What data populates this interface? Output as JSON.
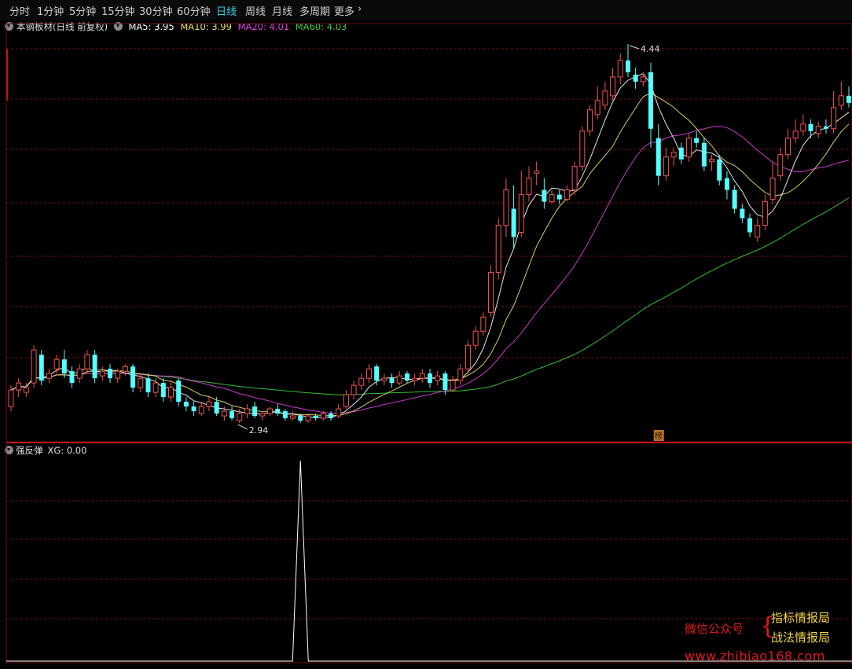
{
  "toolbar": {
    "periods": [
      "分时",
      "1分钟",
      "5分钟",
      "15分钟",
      "30分钟",
      "60分钟",
      "日线",
      "周线",
      "月线",
      "多周期",
      "更多"
    ],
    "active": "日线",
    "more_arrow": "›"
  },
  "main_panel": {
    "stock_title": "本钢板材(日线 前复权)",
    "ma": [
      {
        "label": "MA5: 3.95",
        "color": "#ffffff"
      },
      {
        "label": "MA10: 3.99",
        "color": "#f0e06a"
      },
      {
        "label": "MA20: 4.01",
        "color": "#e040e0"
      },
      {
        "label": "MA60: 4.03",
        "color": "#3ad13a"
      }
    ],
    "high_label": "4.44",
    "low_label": "2.94",
    "badge": "榜"
  },
  "indicator_panel": {
    "name": "强反弹",
    "value_label": "XG: 0.00"
  },
  "watermark": {
    "account": "微信公众号",
    "line1": "指标情报局",
    "line2": "战法情报局",
    "url": "www.zhibiao168.com"
  },
  "colors": {
    "up": "#f0544f",
    "down": "#54ffff",
    "ma5": "#ffffff",
    "ma10": "#f0e06a",
    "ma20": "#e040e0",
    "ma60": "#3ad13a",
    "grid": "#7a1010"
  },
  "chart_data": {
    "type": "candlestick",
    "price_axis_note": "no axis ticks shown",
    "candles": [
      [
        2.98,
        3.05,
        3.07,
        2.96
      ],
      [
        3.05,
        3.08,
        3.1,
        3.02
      ],
      [
        3.04,
        3.06,
        3.08,
        3.02
      ],
      [
        3.08,
        3.22,
        3.24,
        3.06
      ],
      [
        3.2,
        3.09,
        3.22,
        3.07
      ],
      [
        3.1,
        3.12,
        3.14,
        3.08
      ],
      [
        3.14,
        3.18,
        3.2,
        3.12
      ],
      [
        3.18,
        3.12,
        3.22,
        3.1
      ],
      [
        3.13,
        3.08,
        3.15,
        3.06
      ],
      [
        3.1,
        3.14,
        3.16,
        3.08
      ],
      [
        3.14,
        3.2,
        3.22,
        3.12
      ],
      [
        3.2,
        3.1,
        3.22,
        3.08
      ],
      [
        3.11,
        3.13,
        3.15,
        3.09
      ],
      [
        3.14,
        3.1,
        3.16,
        3.08
      ],
      [
        3.1,
        3.13,
        3.14,
        3.08
      ],
      [
        3.13,
        3.15,
        3.16,
        3.11
      ],
      [
        3.15,
        3.06,
        3.16,
        3.04
      ],
      [
        3.06,
        3.1,
        3.12,
        3.04
      ],
      [
        3.1,
        3.04,
        3.12,
        3.02
      ],
      [
        3.04,
        3.08,
        3.1,
        3.02
      ],
      [
        3.08,
        3.02,
        3.1,
        3.0
      ],
      [
        3.02,
        3.06,
        3.08,
        3.0
      ],
      [
        3.09,
        3.0,
        3.1,
        2.98
      ],
      [
        3.0,
        2.98,
        3.02,
        2.96
      ],
      [
        2.98,
        2.96,
        3.0,
        2.94
      ],
      [
        2.95,
        2.98,
        3.0,
        2.94
      ],
      [
        2.98,
        3.0,
        3.02,
        2.96
      ],
      [
        3.0,
        2.95,
        3.02,
        2.94
      ],
      [
        2.94,
        2.96,
        2.98,
        2.92
      ],
      [
        2.96,
        2.93,
        2.98,
        2.92
      ],
      [
        2.92,
        2.95,
        2.97,
        2.91
      ],
      [
        2.95,
        2.97,
        2.99,
        2.93
      ],
      [
        2.98,
        2.94,
        3.0,
        2.93
      ],
      [
        2.94,
        2.95,
        2.96,
        2.92
      ],
      [
        2.95,
        2.97,
        2.98,
        2.94
      ],
      [
        2.97,
        2.95,
        2.99,
        2.94
      ],
      [
        2.96,
        2.93,
        2.97,
        2.92
      ],
      [
        2.93,
        2.94,
        2.96,
        2.92
      ],
      [
        2.94,
        2.92,
        2.95,
        2.91
      ],
      [
        2.92,
        2.94,
        2.95,
        2.91
      ],
      [
        2.94,
        2.93,
        2.95,
        2.92
      ],
      [
        2.93,
        2.95,
        2.96,
        2.92
      ],
      [
        2.95,
        2.93,
        2.96,
        2.92
      ],
      [
        2.94,
        2.97,
        2.99,
        2.93
      ],
      [
        2.98,
        3.03,
        3.05,
        2.97
      ],
      [
        3.03,
        3.07,
        3.09,
        3.01
      ],
      [
        3.07,
        3.1,
        3.12,
        3.05
      ],
      [
        3.1,
        3.14,
        3.16,
        3.08
      ],
      [
        3.15,
        3.09,
        3.16,
        3.07
      ],
      [
        3.09,
        3.1,
        3.12,
        3.07
      ],
      [
        3.1,
        3.08,
        3.12,
        3.06
      ],
      [
        3.08,
        3.11,
        3.13,
        3.07
      ],
      [
        3.12,
        3.09,
        3.13,
        3.08
      ],
      [
        3.09,
        3.1,
        3.12,
        3.07
      ],
      [
        3.1,
        3.12,
        3.14,
        3.08
      ],
      [
        3.12,
        3.08,
        3.14,
        3.06
      ],
      [
        3.09,
        3.11,
        3.13,
        3.07
      ],
      [
        3.12,
        3.05,
        3.13,
        3.03
      ],
      [
        3.05,
        3.09,
        3.11,
        3.04
      ],
      [
        3.09,
        3.14,
        3.16,
        3.07
      ],
      [
        3.14,
        3.24,
        3.26,
        3.12
      ],
      [
        3.24,
        3.3,
        3.32,
        3.22
      ],
      [
        3.3,
        3.36,
        3.38,
        3.28
      ],
      [
        3.38,
        3.55,
        3.58,
        3.36
      ],
      [
        3.55,
        3.75,
        3.78,
        3.52
      ],
      [
        3.75,
        3.9,
        3.95,
        3.7
      ],
      [
        3.82,
        3.7,
        3.92,
        3.65
      ],
      [
        3.72,
        3.88,
        3.98,
        3.7
      ],
      [
        3.88,
        3.95,
        4.0,
        3.85
      ],
      [
        3.97,
        3.98,
        4.02,
        3.92
      ],
      [
        3.9,
        3.85,
        3.95,
        3.82
      ],
      [
        3.85,
        3.88,
        3.9,
        3.84
      ],
      [
        3.88,
        3.86,
        3.9,
        3.84
      ],
      [
        3.86,
        3.9,
        3.92,
        3.85
      ],
      [
        3.9,
        4.0,
        4.02,
        3.88
      ],
      [
        4.0,
        4.15,
        4.17,
        3.98
      ],
      [
        4.15,
        4.24,
        4.26,
        4.13
      ],
      [
        4.22,
        4.28,
        4.34,
        4.2
      ],
      [
        4.26,
        4.32,
        4.36,
        4.24
      ],
      [
        4.3,
        4.38,
        4.42,
        4.28
      ],
      [
        4.38,
        4.45,
        4.48,
        4.35
      ],
      [
        4.45,
        4.4,
        4.52,
        4.38
      ],
      [
        4.39,
        4.36,
        4.42,
        4.33
      ],
      [
        4.36,
        4.38,
        4.4,
        4.34
      ],
      [
        4.4,
        4.16,
        4.44,
        4.08
      ],
      [
        4.12,
        3.96,
        4.18,
        3.92
      ],
      [
        3.96,
        4.04,
        4.08,
        3.94
      ],
      [
        4.04,
        4.06,
        4.08,
        4.0
      ],
      [
        4.08,
        4.03,
        4.1,
        4.01
      ],
      [
        4.04,
        4.12,
        4.14,
        4.02
      ],
      [
        4.12,
        4.1,
        4.15,
        4.08
      ],
      [
        4.1,
        4.0,
        4.12,
        3.98
      ],
      [
        4.02,
        4.03,
        4.05,
        3.98
      ],
      [
        4.03,
        3.94,
        4.05,
        3.92
      ],
      [
        3.95,
        3.9,
        3.98,
        3.86
      ],
      [
        3.9,
        3.82,
        3.92,
        3.8
      ],
      [
        3.82,
        3.78,
        3.84,
        3.76
      ],
      [
        3.78,
        3.72,
        3.8,
        3.7
      ],
      [
        3.7,
        3.75,
        3.78,
        3.68
      ],
      [
        3.75,
        3.85,
        3.88,
        3.73
      ],
      [
        3.86,
        3.95,
        4.02,
        3.84
      ],
      [
        3.96,
        4.05,
        4.08,
        3.94
      ],
      [
        4.05,
        4.12,
        4.16,
        4.03
      ],
      [
        4.12,
        4.15,
        4.2,
        4.1
      ],
      [
        4.15,
        4.18,
        4.22,
        4.13
      ],
      [
        4.18,
        4.15,
        4.2,
        4.12
      ],
      [
        4.14,
        4.17,
        4.19,
        4.12
      ],
      [
        4.17,
        4.16,
        4.2,
        4.14
      ],
      [
        4.16,
        4.25,
        4.32,
        4.14
      ],
      [
        4.26,
        4.3,
        4.36,
        4.24
      ],
      [
        4.3,
        4.27,
        4.34,
        4.25
      ]
    ],
    "spike_index": 38,
    "xg_current": 0.0
  }
}
